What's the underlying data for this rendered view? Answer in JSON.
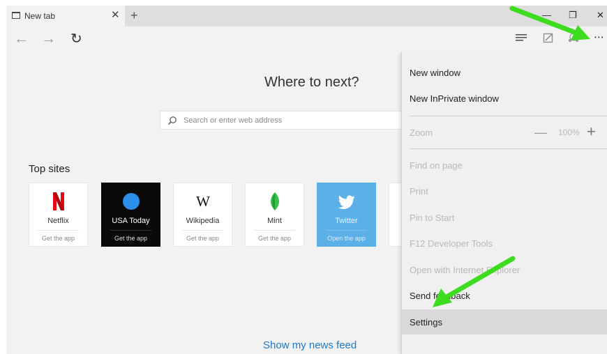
{
  "tab": {
    "title": "New tab",
    "favicon": "page-icon",
    "close_glyph": "✕"
  },
  "new_tab_glyph": "+",
  "window_controls": {
    "minimize": "—",
    "restore": "❐",
    "close": "✕"
  },
  "nav": {
    "back": "←",
    "forward": "→",
    "refresh": "↻",
    "more": "⋯"
  },
  "toolbar_icons": [
    "reading-list-icon",
    "web-note-icon",
    "share-icon"
  ],
  "page": {
    "heading": "Where to next?",
    "search_placeholder": "Search or enter web address",
    "top_sites_title": "Top sites",
    "news_feed_link": "Show my news feed"
  },
  "top_sites": [
    {
      "name": "Netflix",
      "action": "Get the app",
      "icon": "netflix-logo",
      "style": "light"
    },
    {
      "name": "USA Today",
      "action": "Get the app",
      "icon": "usa-today-logo",
      "style": "dark"
    },
    {
      "name": "Wikipedia",
      "action": "Get the app",
      "icon": "wikipedia-logo",
      "style": "light"
    },
    {
      "name": "Mint",
      "action": "Get the app",
      "icon": "mint-logo",
      "style": "light"
    },
    {
      "name": "Twitter",
      "action": "Open the app",
      "icon": "twitter-logo",
      "style": "blue"
    }
  ],
  "menu": {
    "new_window": "New window",
    "new_inprivate": "New InPrivate window",
    "zoom_label": "Zoom",
    "zoom_minus": "—",
    "zoom_level": "100%",
    "zoom_plus": "+",
    "find_on_page": "Find on page",
    "print": "Print",
    "pin_to_start": "Pin to Start",
    "f12_tools": "F12 Developer Tools",
    "open_with_ie": "Open with Internet Explorer",
    "send_feedback": "Send feedback",
    "settings": "Settings"
  },
  "colors": {
    "accent_link": "#1f79c8",
    "annotation_arrow": "#3ddc1f",
    "netflix_red": "#e50914",
    "usa_today_blue": "#2b8ee8",
    "twitter_blue": "#5cb0e8"
  }
}
